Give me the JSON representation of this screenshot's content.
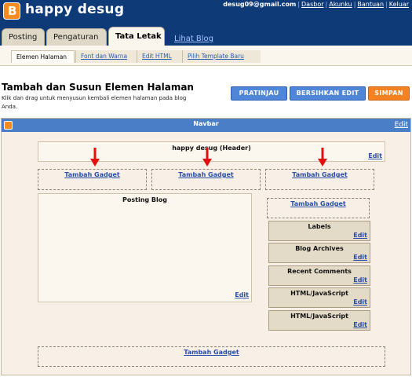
{
  "header": {
    "blog_title": "happy desug",
    "email": "desug09@gmail.com",
    "links": [
      "Dasbor",
      "Akunku",
      "Bantuan",
      "Keluar"
    ]
  },
  "tabs": [
    "Posting",
    "Pengaturan",
    "Tata Letak",
    "Lihat Blog"
  ],
  "subtabs": [
    "Elemen Halaman",
    "Font dan Warna",
    "Edit HTML",
    "Pilih Template Baru"
  ],
  "page": {
    "title": "Tambah dan Susun Elemen Halaman",
    "description": "Klik dan drag untuk menyusun kembali elemen halaman pada blog Anda."
  },
  "buttons": {
    "preview": "PRATINJAU",
    "clear": "BERSIHKAN EDIT",
    "save": "SIMPAN"
  },
  "layout": {
    "navbar_title": "Navbar",
    "edit_label": "Edit",
    "header_title": "happy desug (Header)",
    "add_gadget": "Tambah Gadget",
    "main_title": "Posting Blog",
    "sidebar_widgets": [
      "Labels",
      "Blog Archives",
      "Recent Comments",
      "HTML/JavaScript",
      "HTML/JavaScript"
    ]
  },
  "colors": {
    "header_bg": "#0f3a78",
    "navbar_bg": "#4a7fc8",
    "button_blue": "#4f86d8",
    "button_orange": "#f58220",
    "arrow": "#e01010",
    "editor_bg": "#f8f0e6"
  }
}
